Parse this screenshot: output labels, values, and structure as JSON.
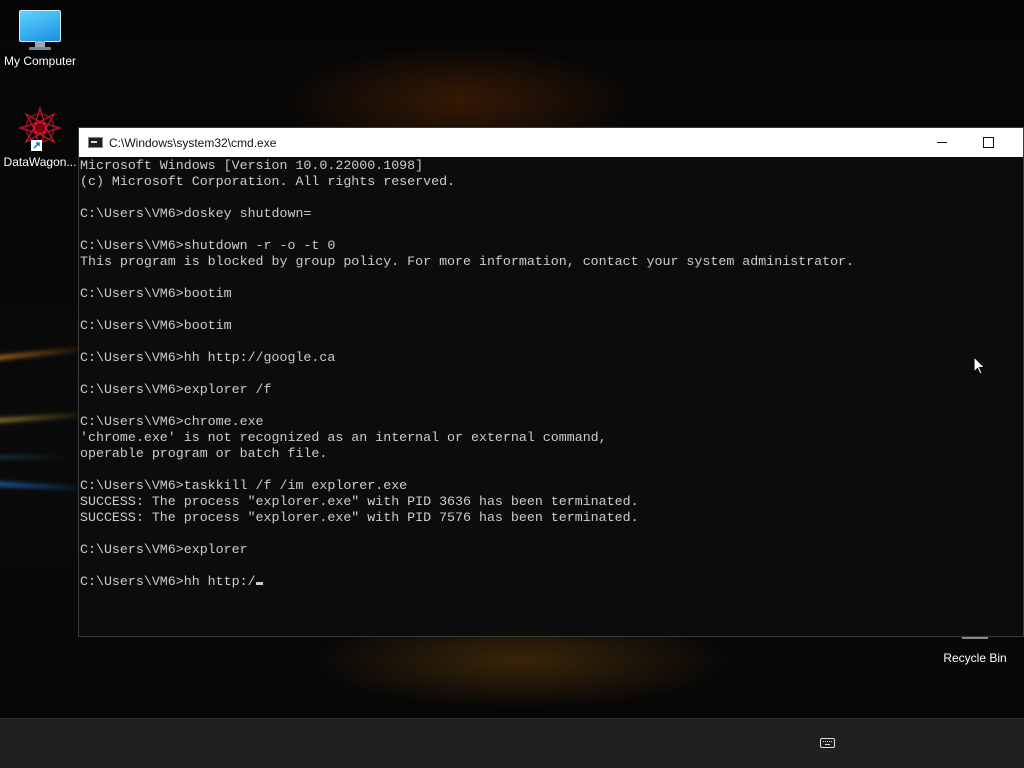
{
  "desktop": {
    "icons": [
      {
        "label": "My Computer",
        "icon": "computer-icon"
      },
      {
        "label": "DataWagon...",
        "icon": "datawagon-shortcut-icon"
      }
    ],
    "recycle_bin": {
      "label": "Recycle Bin",
      "icon": "recycle-bin-icon"
    }
  },
  "window": {
    "title": "C:\\Windows\\system32\\cmd.exe",
    "app_icon": "cmd-icon",
    "controls": {
      "minimize": "minimize-icon",
      "maximize": "maximize-icon"
    }
  },
  "console": {
    "lines": [
      "Microsoft Windows [Version 10.0.22000.1098]",
      "(c) Microsoft Corporation. All rights reserved.",
      "",
      "C:\\Users\\VM6>doskey shutdown=",
      "",
      "C:\\Users\\VM6>shutdown -r -o -t 0",
      "This program is blocked by group policy. For more information, contact your system administrator.",
      "",
      "C:\\Users\\VM6>bootim",
      "",
      "C:\\Users\\VM6>bootim",
      "",
      "C:\\Users\\VM6>hh http://google.ca",
      "",
      "C:\\Users\\VM6>explorer /f",
      "",
      "C:\\Users\\VM6>chrome.exe",
      "'chrome.exe' is not recognized as an internal or external command,",
      "operable program or batch file.",
      "",
      "C:\\Users\\VM6>taskkill /f /im explorer.exe",
      "SUCCESS: The process \"explorer.exe\" with PID 3636 has been terminated.",
      "SUCCESS: The process \"explorer.exe\" with PID 7576 has been terminated.",
      "",
      "C:\\Users\\VM6>explorer",
      "",
      "C:\\Users\\VM6>hh http:/"
    ]
  },
  "taskbar": {
    "tray_icon": "touch-keyboard-icon"
  },
  "colors": {
    "console_bg": "#0c0c0c",
    "console_fg": "#cccccc",
    "titlebar_bg": "#ffffff",
    "taskbar_bg": "#202020"
  }
}
